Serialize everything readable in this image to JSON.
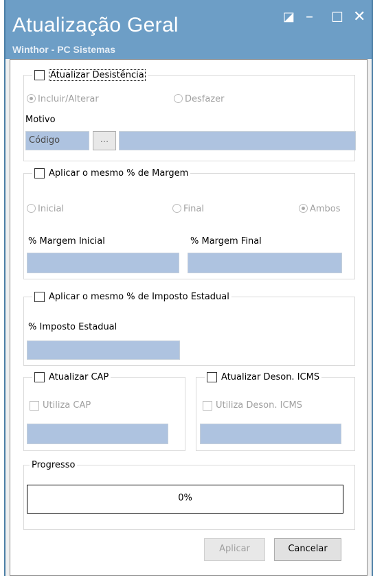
{
  "window": {
    "title": "Atualização Geral",
    "subtitle": "Winthor - PC Sistemas",
    "controls": {
      "restore": "◪",
      "minimize": "–",
      "maximize": "☐",
      "close": "✕"
    }
  },
  "desistencia": {
    "checkbox_label": "Atualizar Desistência",
    "radio_incluir": "Incluir/Alterar",
    "radio_desfazer": "Desfazer",
    "motivo_label": "Motivo",
    "codigo_value": "Código",
    "browse_label": "..."
  },
  "margem": {
    "checkbox_label": "Aplicar o mesmo % de Margem",
    "radio_inicial": "Inicial",
    "radio_final": "Final",
    "radio_ambos": "Ambos",
    "margem_inicial_label": "% Margem Inicial",
    "margem_final_label": "% Margem Final"
  },
  "imposto": {
    "checkbox_label": "Aplicar o mesmo % de Imposto Estadual",
    "imposto_label": "% Imposto Estadual"
  },
  "cap": {
    "checkbox_label": "Atualizar CAP",
    "utiliza_label": "Utiliza CAP"
  },
  "icms": {
    "checkbox_label": "Atualizar Deson. ICMS",
    "utiliza_label": "Utiliza Deson. ICMS"
  },
  "progress": {
    "group_label": "Progresso",
    "text": "0%",
    "value": 0
  },
  "buttons": {
    "aplicar": "Aplicar",
    "cancelar": "Cancelar"
  },
  "colors": {
    "titlebar": "#6d9ec6",
    "input_fill": "#aec3e0"
  }
}
